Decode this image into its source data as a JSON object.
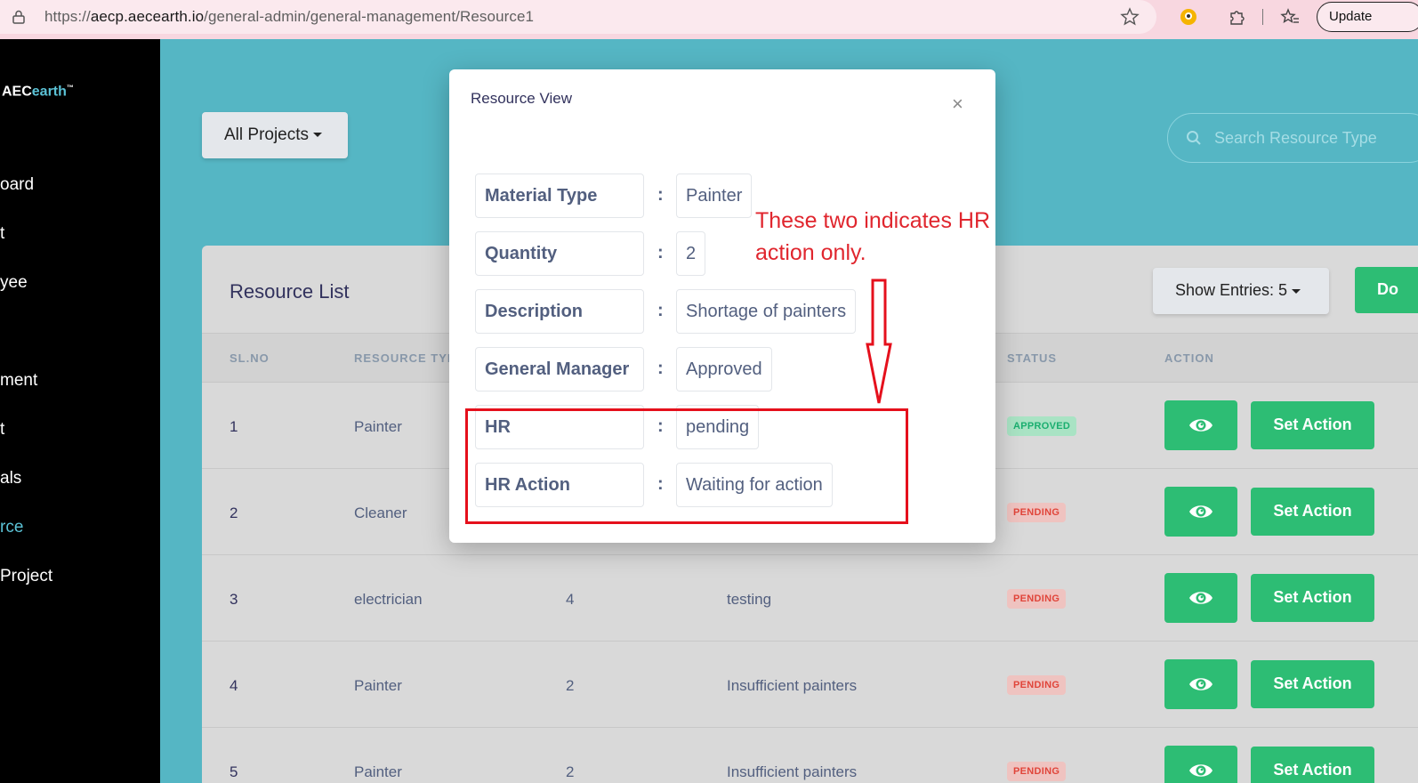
{
  "browser": {
    "url_prefix": "https://",
    "url_host": "aecp.aecearth.io",
    "url_path": "/general-admin/general-management/Resource1",
    "update_label": "Update"
  },
  "sidebar": {
    "logo_aec": "AEC",
    "logo_earth": "earth",
    "logo_tm": "™",
    "items": [
      {
        "label": "oard"
      },
      {
        "label": "t"
      },
      {
        "label": "yee"
      },
      {
        "label": "ment"
      },
      {
        "label": "t"
      },
      {
        "label": "als"
      },
      {
        "label": "rce",
        "active": true
      },
      {
        "label": "Project"
      }
    ]
  },
  "main": {
    "projects_label": "All Projects",
    "search_placeholder": "Search Resource Type"
  },
  "card": {
    "title": "Resource List",
    "entries_label": "Show Entries: 5",
    "top_button_label": "Do",
    "headers": [
      "SL.NO",
      "RESOURCE TYP",
      "STATUS",
      "ACTION"
    ],
    "rows": [
      {
        "sl": "1",
        "type": "Painter",
        "qty": "",
        "desc": "",
        "status": "APPROVED"
      },
      {
        "sl": "2",
        "type": "Cleaner",
        "qty": "",
        "desc": "",
        "status": "PENDING"
      },
      {
        "sl": "3",
        "type": "electrician",
        "qty": "4",
        "desc": "testing",
        "status": "PENDING"
      },
      {
        "sl": "4",
        "type": "Painter",
        "qty": "2",
        "desc": "Insufficient painters",
        "status": "PENDING"
      },
      {
        "sl": "5",
        "type": "Painter",
        "qty": "2",
        "desc": "Insufficient painters",
        "status": "PENDING"
      }
    ],
    "set_action_label": "Set Action"
  },
  "modal": {
    "title": "Resource View",
    "close": "×",
    "fields": [
      {
        "label": "Material Type",
        "colon": ":",
        "value": "Painter"
      },
      {
        "label": "Quantity",
        "colon": ":",
        "value": "2"
      },
      {
        "label": "Description",
        "colon": ":",
        "value": "Shortage of painters"
      },
      {
        "label": "General Manager",
        "colon": ":",
        "value": "Approved"
      },
      {
        "label": "HR",
        "colon": ":",
        "value": "pending"
      },
      {
        "label": "HR Action",
        "colon": ":",
        "value": "Waiting for action"
      }
    ]
  },
  "annotation": {
    "line1": "These two indicates HR",
    "line2": "action only.",
    "color": "#e0262e"
  }
}
